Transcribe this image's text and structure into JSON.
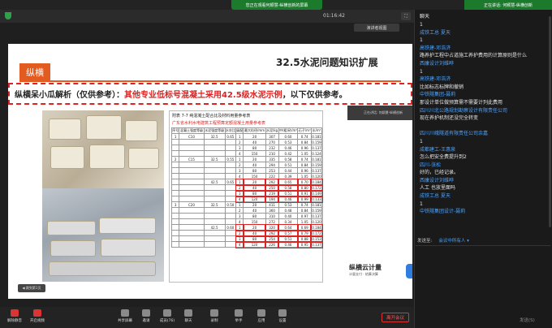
{
  "top_banner": {
    "viewing": "您正在观看何颖慧-纵横创新的屏幕"
  },
  "right_banner": {
    "speaking": "正在讲话: 何颖慧-纵横创新"
  },
  "meeting": {
    "timer": "01:16:42",
    "view_mode": "演讲者视图"
  },
  "slide": {
    "title": "32.5水泥问题知识扩展",
    "logo_text": "纵横",
    "callout_black1": "纵横呆小瓜解析（仅供参考）：",
    "callout_red": "其他专业低标号混凝土采用42.5级水泥示例",
    "callout_black2": "，以下仅供参考。",
    "table_caption": "附表 7-7    纯混凝土配合比及材料用量参考表",
    "table_subtitle": "广东省水利水电建筑工程预算定额混凝土用量参考表",
    "table_header": [
      "序号",
      "混凝土强度等级",
      "水泥强度等级",
      "水灰比",
      "级配",
      "最大粒径/mm",
      "水泥/kg",
      "中(粗)砂/m³",
      "石子/m³",
      "水/m³"
    ],
    "table_rows": [
      [
        "1",
        "C10",
        "32.5",
        "0.65",
        "1",
        "20",
        "307",
        "0.60",
        "0.74",
        "0.181"
      ],
      [
        "",
        "",
        "",
        "",
        "2",
        "40",
        "270",
        "0.53",
        "0.84",
        "0.159"
      ],
      [
        "",
        "",
        "",
        "",
        "3",
        "80",
        "232",
        "0.46",
        "0.96",
        "0.137"
      ],
      [
        "",
        "",
        "",
        "",
        "4",
        "150",
        "210",
        "0.42",
        "1.05",
        "0.124"
      ],
      [
        "2",
        "C15",
        "32.5",
        "0.55",
        "1",
        "20",
        "335",
        "0.58",
        "0.74",
        "0.181"
      ],
      [
        "",
        "",
        "",
        "",
        "2",
        "40",
        "294",
        "0.51",
        "0.84",
        "0.159"
      ],
      [
        "",
        "",
        "",
        "",
        "3",
        "80",
        "253",
        "0.44",
        "0.96",
        "0.137"
      ],
      [
        "",
        "",
        "",
        "",
        "4",
        "150",
        "222",
        "0.39",
        "1.05",
        "0.120"
      ],
      [
        "",
        "",
        "42.5",
        "0.65",
        "1",
        "20",
        "292",
        "0.65",
        "0.70",
        "0.184"
      ],
      [
        "",
        "",
        "",
        "",
        "2",
        "40",
        "250",
        "0.58",
        "0.80",
        "0.172"
      ],
      [
        "",
        "",
        "",
        "",
        "3",
        "80",
        "219",
        "0.51",
        "0.91",
        "0.149"
      ],
      [
        "",
        "",
        "",
        "",
        "4",
        "120",
        "194",
        "0.46",
        "0.99",
        "0.133"
      ],
      [
        "3",
        "C20",
        "32.5",
        "0.50",
        "1",
        "20",
        "411",
        "0.53",
        "0.74",
        "0.181"
      ],
      [
        "",
        "",
        "",
        "",
        "2",
        "40",
        "360",
        "0.48",
        "0.84",
        "0.159"
      ],
      [
        "",
        "",
        "",
        "",
        "3",
        "80",
        "310",
        "0.40",
        "0.97",
        "0.137"
      ],
      [
        "",
        "",
        "",
        "",
        "4",
        "150",
        "272",
        "0.34",
        "1.05",
        "0.120"
      ],
      [
        "",
        "",
        "42.5",
        "0.60",
        "1",
        "20",
        "320",
        "0.64",
        "0.69",
        "0.184"
      ],
      [
        "",
        "",
        "",
        "",
        "2",
        "40",
        "292",
        "0.57",
        "0.79",
        "0.172"
      ],
      [
        "",
        "",
        "",
        "",
        "3",
        "80",
        "254",
        "0.51",
        "0.88",
        "0.153"
      ],
      [
        "",
        "",
        "",
        "",
        "4",
        "120",
        "226",
        "0.46",
        "0.95",
        "0.137"
      ]
    ],
    "brand_title": "纵横云计量",
    "brand_sub": "计量支付 · 结算决算",
    "ppt_button": "◀ 跳到第1页",
    "video_label": "正在讲话: 何颖慧-纵横创新"
  },
  "toolbar": {
    "items": [
      {
        "label": "解除静音",
        "icon": "mic-muted-icon"
      },
      {
        "label": "开启视频",
        "icon": "camera-off-icon"
      },
      {
        "label": "共享屏幕",
        "icon": "share-screen-icon"
      },
      {
        "label": "邀请",
        "icon": "invite-icon"
      },
      {
        "label": "成员(76)",
        "icon": "members-icon"
      },
      {
        "label": "聊天",
        "icon": "chat-icon"
      },
      {
        "label": "录制",
        "icon": "record-icon"
      },
      {
        "label": "举手",
        "icon": "raise-hand-icon"
      },
      {
        "label": "应用",
        "icon": "apps-icon"
      },
      {
        "label": "设置",
        "icon": "settings-icon"
      }
    ],
    "leave": "离开会议"
  },
  "chat": {
    "title": "聊天",
    "messages": [
      {
        "type": "body",
        "text": "1"
      },
      {
        "type": "name",
        "text": "成铁工总 夏天"
      },
      {
        "type": "body",
        "text": "1"
      },
      {
        "type": "name",
        "text": "高铁建-邓浩济"
      },
      {
        "type": "body",
        "text": "路养护工程中占道施工养护费用的计算原则是什么"
      },
      {
        "type": "name",
        "text": "西康设计刘维晔"
      },
      {
        "type": "body",
        "text": "1"
      },
      {
        "type": "name",
        "text": "高铁建-邓浩济"
      },
      {
        "type": "body",
        "text": "比如标志标牌和撤销"
      },
      {
        "type": "name",
        "text": "中铁隧集团-聂莉"
      },
      {
        "type": "body",
        "text": "那设计单位做预算需不需要计列此费用"
      },
      {
        "type": "name",
        "text": "四川川北公路规划勘察设计有限责任公司"
      },
      {
        "type": "body",
        "text": "现在养护机制还没完全转变"
      },
      {
        "type": "body",
        "text": ""
      },
      {
        "type": "name",
        "text": "四川川峨隧道有限责任公司余嘉"
      },
      {
        "type": "body",
        "text": "1"
      },
      {
        "type": "name",
        "text": "成都建工-王惠泉"
      },
      {
        "type": "body",
        "text": "怎么把安全费提升到2"
      },
      {
        "type": "name",
        "text": "四川-张松"
      },
      {
        "type": "body",
        "text": "好的，已经记录。"
      },
      {
        "type": "name",
        "text": "西康设计刘维晔"
      },
      {
        "type": "body",
        "text": "人工 也放里面吗"
      },
      {
        "type": "name",
        "text": "成铁工总 夏天"
      },
      {
        "type": "body",
        "text": "1"
      },
      {
        "type": "name",
        "text": "中铁隧集团设计-聂莉"
      }
    ],
    "send_label": "发送至:",
    "send_to": "会议中所有人 ▾",
    "send_button": "发送(S)"
  }
}
